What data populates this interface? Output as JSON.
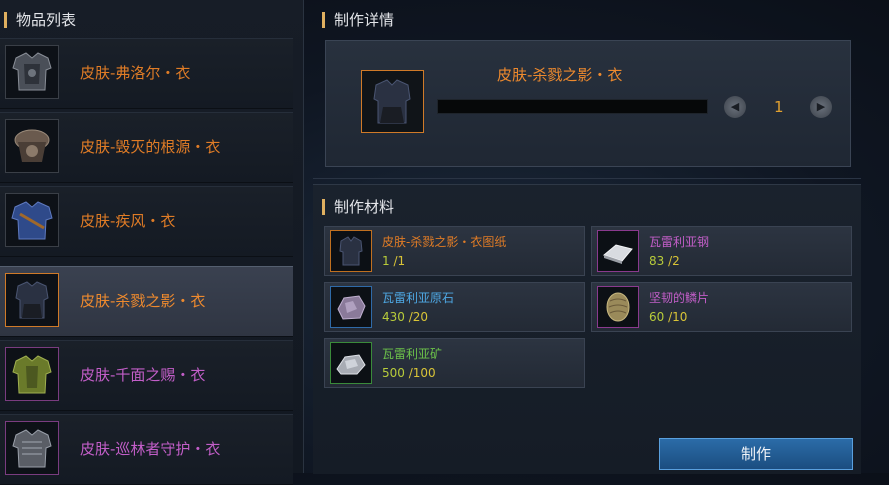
{
  "item_list": {
    "title": "物品列表",
    "items": [
      {
        "name": "皮肤-弗洛尔・衣",
        "rarity": "orange",
        "icon": "armor-icon"
      },
      {
        "name": "皮肤-毁灭的根源・衣",
        "rarity": "orange",
        "icon": "armor-icon"
      },
      {
        "name": "皮肤-疾风・衣",
        "rarity": "orange",
        "icon": "armor-icon"
      },
      {
        "name": "皮肤-杀戮之影・衣",
        "rarity": "orange",
        "icon": "armor-icon",
        "selected": true
      },
      {
        "name": "皮肤-千面之赐・衣",
        "rarity": "purple",
        "icon": "armor-icon"
      },
      {
        "name": "皮肤-巡林者守护・衣",
        "rarity": "purple",
        "icon": "armor-icon"
      }
    ]
  },
  "detail": {
    "title": "制作详情",
    "item_name": "皮肤-杀戮之影・衣",
    "quantity": "1",
    "decrease_icon": "◀",
    "increase_icon": "▶"
  },
  "materials": {
    "title": "制作材料",
    "list": [
      {
        "name": "皮肤-杀戮之影・衣图纸",
        "have": "1",
        "need": "/1",
        "color": "orange",
        "icon": "blueprint-icon"
      },
      {
        "name": "瓦雷利亚钢",
        "have": "83",
        "need": "/2",
        "color": "purple",
        "icon": "steel-ingot-icon"
      },
      {
        "name": "瓦雷利亚原石",
        "have": "430",
        "need": "/20",
        "color": "blue",
        "icon": "ore-stone-icon"
      },
      {
        "name": "坚韧的鳞片",
        "have": "60",
        "need": "/10",
        "color": "purple",
        "icon": "scale-icon"
      },
      {
        "name": "瓦雷利亚矿",
        "have": "500",
        "need": "/100",
        "color": "green",
        "icon": "ore-icon"
      }
    ]
  },
  "craft_button": {
    "label": "制作"
  },
  "colors": {
    "rarity_orange": "#e07c26",
    "rarity_purple": "#c25ec8",
    "rarity_blue": "#4ea8e4",
    "rarity_green": "#6cc24a",
    "accent": "#e0b060",
    "button": "#2b6ca8"
  }
}
